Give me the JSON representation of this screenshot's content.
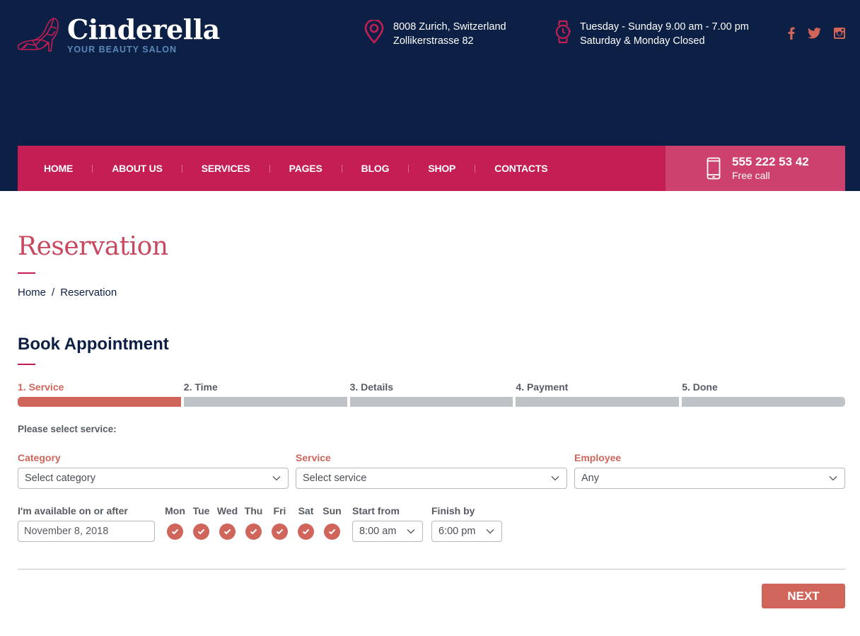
{
  "header": {
    "brand": {
      "title": "Cinderella",
      "subtitle": "YOUR BEAUTY SALON"
    },
    "address": {
      "icon": "map-pin-icon",
      "line1": "8008 Zurich, Switzerland",
      "line2": "Zollikerstrasse 82"
    },
    "hours": {
      "icon": "watch-icon",
      "line1": "Tuesday - Sunday 9.00 am - 7.00 pm",
      "line2": "Saturday & Monday Closed"
    },
    "social": [
      {
        "name": "facebook",
        "icon": "facebook-icon",
        "glyph": "f"
      },
      {
        "name": "twitter",
        "icon": "twitter-icon",
        "glyph": "t"
      },
      {
        "name": "instagram",
        "icon": "instagram-icon",
        "glyph": "ig"
      }
    ]
  },
  "nav": {
    "items": [
      "HOME",
      "ABOUT US",
      "SERVICES",
      "PAGES",
      "BLOG",
      "SHOP",
      "CONTACTS"
    ],
    "phone": {
      "number": "555 222 53 42",
      "label": "Free call",
      "icon": "mobile-phone-icon"
    }
  },
  "page": {
    "title": "Reservation",
    "breadcrumb": {
      "home": "Home",
      "separator": "/",
      "current": "Reservation"
    }
  },
  "booking": {
    "title": "Book Appointment",
    "steps": [
      {
        "label": "1. Service",
        "active": true
      },
      {
        "label": "2. Time",
        "active": false
      },
      {
        "label": "3. Details",
        "active": false
      },
      {
        "label": "4. Payment",
        "active": false
      },
      {
        "label": "5. Done",
        "active": false
      }
    ],
    "prompt": "Please select service:",
    "category": {
      "label": "Category",
      "value": "Select category"
    },
    "service": {
      "label": "Service",
      "value": "Select service"
    },
    "employee": {
      "label": "Employee",
      "value": "Any"
    },
    "available": {
      "label": "I'm available on or after",
      "value": "November 8, 2018"
    },
    "days": [
      {
        "label": "Mon",
        "checked": true
      },
      {
        "label": "Tue",
        "checked": true
      },
      {
        "label": "Wed",
        "checked": true
      },
      {
        "label": "Thu",
        "checked": true
      },
      {
        "label": "Fri",
        "checked": true
      },
      {
        "label": "Sat",
        "checked": true
      },
      {
        "label": "Sun",
        "checked": true
      }
    ],
    "start_from": {
      "label": "Start from",
      "value": "8:00 am"
    },
    "finish_by": {
      "label": "Finish by",
      "value": "6:00 pm"
    },
    "next_label": "NEXT"
  },
  "colors": {
    "header_bg": "#0c1f45",
    "nav_bg": "#c41e54",
    "phone_bg": "#cd416f",
    "accent": "#d0665b",
    "title": "#c8485f",
    "step_inactive": "#bec3c7"
  }
}
